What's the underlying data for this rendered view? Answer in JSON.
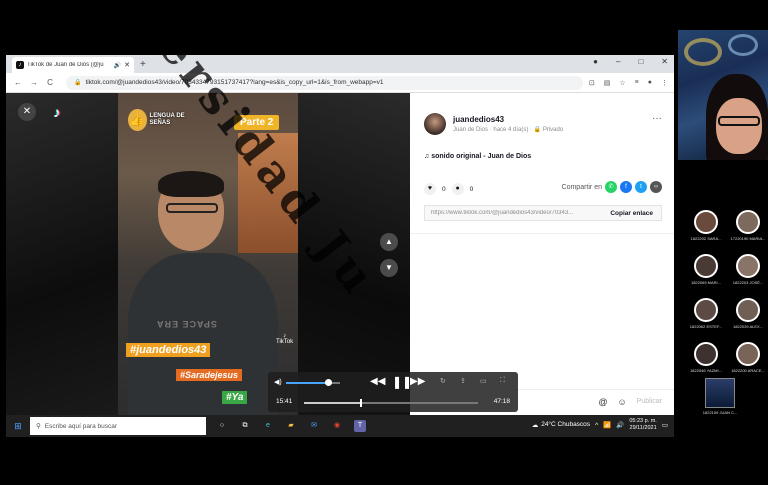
{
  "browser": {
    "tab_title": "TikTok de Juan de Dios (@ju",
    "tab_audio_icon": "speaker-icon",
    "new_tab": "+",
    "url": "tiktok.com/@juandedios43/video/7034334793151737417?lang=es&is_copy_url=1&is_from_webapp=v1",
    "window_controls": [
      "–",
      "□",
      "✕"
    ]
  },
  "video": {
    "lengua_text": "LENGUA DE SEÑAS",
    "parte": "Parte 2",
    "shirt_text": "SPACE ERA",
    "tag1": "#juandedios43",
    "tag2": "#Saradejesus",
    "tag3": "#Ya",
    "tiktok_watermark": "TikTok"
  },
  "post": {
    "username": "juandedios43",
    "meta": "Juan de Dios · hace 4 día(s) · 🔒 Privado",
    "sound": "♫  sonido original - Juan de Dios",
    "likes": "0",
    "comments": "0",
    "share_label": "Compartir en",
    "link": "https://www.tiktok.com/@juandedios43/video/70343...",
    "copy_label": "Copiar enlace",
    "publish_label": "Publicar"
  },
  "player": {
    "current_time": "15:41",
    "total_time": "47:18",
    "volume_level": 0.78,
    "progress": 0.33
  },
  "taskbar": {
    "search_placeholder": "Escribe aquí para buscar",
    "weather": "24°C  Chubascos",
    "time": "05:23 p. m.",
    "date": "29/11/2021"
  },
  "participants": [
    {
      "name": "1822202 SARA..."
    },
    {
      "name": "17220190 MARIA..."
    },
    {
      "name": "1822069 MARI..."
    },
    {
      "name": "1822203 JOSÉ..."
    },
    {
      "name": "1822062 ESTEF..."
    },
    {
      "name": "1822039 ALEX..."
    },
    {
      "name": "1822046 YAZMI..."
    },
    {
      "name": "1822200 ARACE..."
    }
  ],
  "self_participant": {
    "name": "1822159 JUAN C..."
  },
  "watermark_text": "ersidad Ju",
  "colors": {
    "share_whatsapp": "#25d366",
    "share_facebook": "#1877f2",
    "share_twitter": "#1da1f2",
    "share_embed": "#555555",
    "participant_avatars": [
      "#6b4a3e",
      "#7d6a5c",
      "#4a3a36",
      "#8a7468",
      "#5d4a44",
      "#6f5f55",
      "#3e3230",
      "#7a6458"
    ]
  }
}
